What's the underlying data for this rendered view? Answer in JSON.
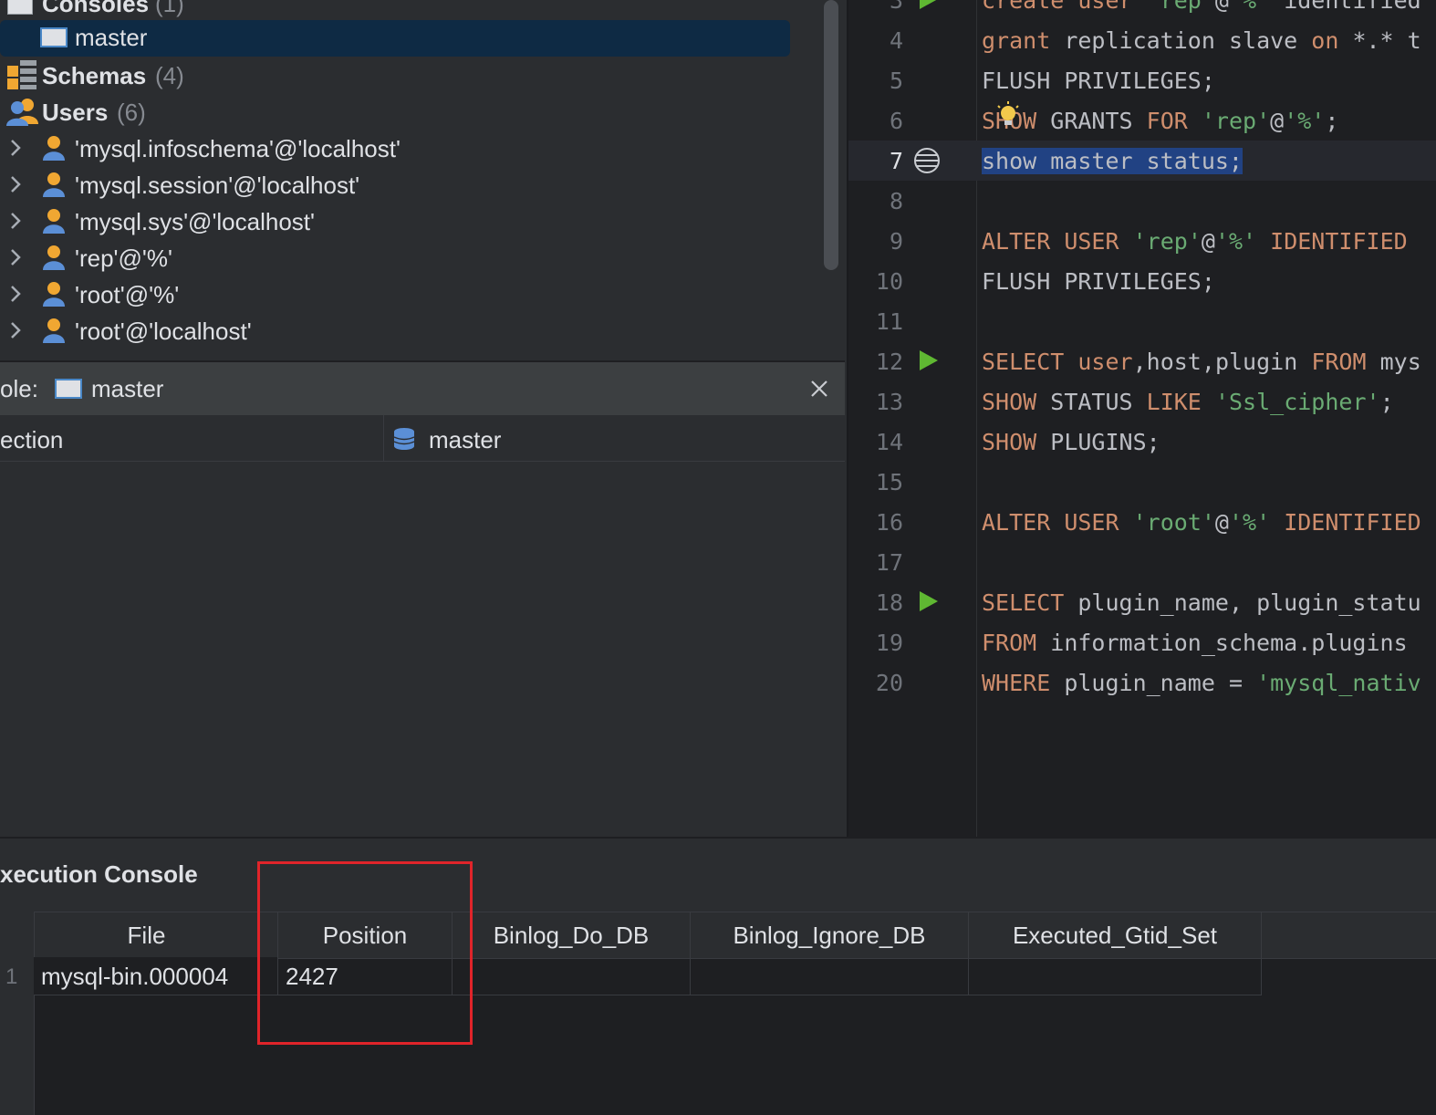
{
  "tree": {
    "consoles": {
      "label": "Consoles",
      "count": "(1)"
    },
    "console_item": "master",
    "schemas": {
      "label": "Schemas",
      "count": "(4)"
    },
    "users": {
      "label": "Users",
      "count": "(6)"
    },
    "user_items": [
      "'mysql.infoschema'@'localhost'",
      "'mysql.session'@'localhost'",
      "'mysql.sys'@'localhost'",
      "'rep'@'%'",
      "'root'@'%'",
      "'root'@'localhost'"
    ]
  },
  "properties": {
    "title_prefix": "ole:",
    "title_value": "master",
    "row_label": "ection",
    "row_value": "master"
  },
  "editor": {
    "lines": [
      {
        "n": "3",
        "code": "create user 'rep'@'%' identified"
      },
      {
        "n": "4",
        "code": "grant replication slave on *.* t"
      },
      {
        "n": "5",
        "code": "FLUSH PRIVILEGES;"
      },
      {
        "n": "6",
        "code": "SHOW GRANTS FOR 'rep'@'%';"
      },
      {
        "n": "7",
        "code": "show master status;"
      },
      {
        "n": "8",
        "code": ""
      },
      {
        "n": "9",
        "code": "ALTER USER 'rep'@'%' IDENTIFIED"
      },
      {
        "n": "10",
        "code": "FLUSH PRIVILEGES;"
      },
      {
        "n": "11",
        "code": ""
      },
      {
        "n": "12",
        "code": "SELECT user,host,plugin FROM mys"
      },
      {
        "n": "13",
        "code": "SHOW STATUS LIKE 'Ssl_cipher';"
      },
      {
        "n": "14",
        "code": "SHOW PLUGINS;"
      },
      {
        "n": "15",
        "code": ""
      },
      {
        "n": "16",
        "code": "ALTER USER 'root'@'%' IDENTIFIED"
      },
      {
        "n": "17",
        "code": ""
      },
      {
        "n": "18",
        "code": "SELECT plugin_name, plugin_statu"
      },
      {
        "n": "19",
        "code": "FROM information_schema.plugins"
      },
      {
        "n": "20",
        "code": "WHERE plugin_name = 'mysql_nativ"
      }
    ]
  },
  "execution_console": {
    "title": "xecution Console",
    "columns": [
      "File",
      "Position",
      "Binlog_Do_DB",
      "Binlog_Ignore_DB",
      "Executed_Gtid_Set"
    ],
    "rows": [
      {
        "num": "1",
        "cells": [
          "mysql-bin.000004",
          "2427",
          "",
          "",
          ""
        ]
      }
    ]
  },
  "colors": {
    "keyword": "#cf8e6d",
    "string": "#6aab73",
    "selection": "#214283",
    "highlight_box": "#e0242a",
    "run": "#5fb832"
  }
}
